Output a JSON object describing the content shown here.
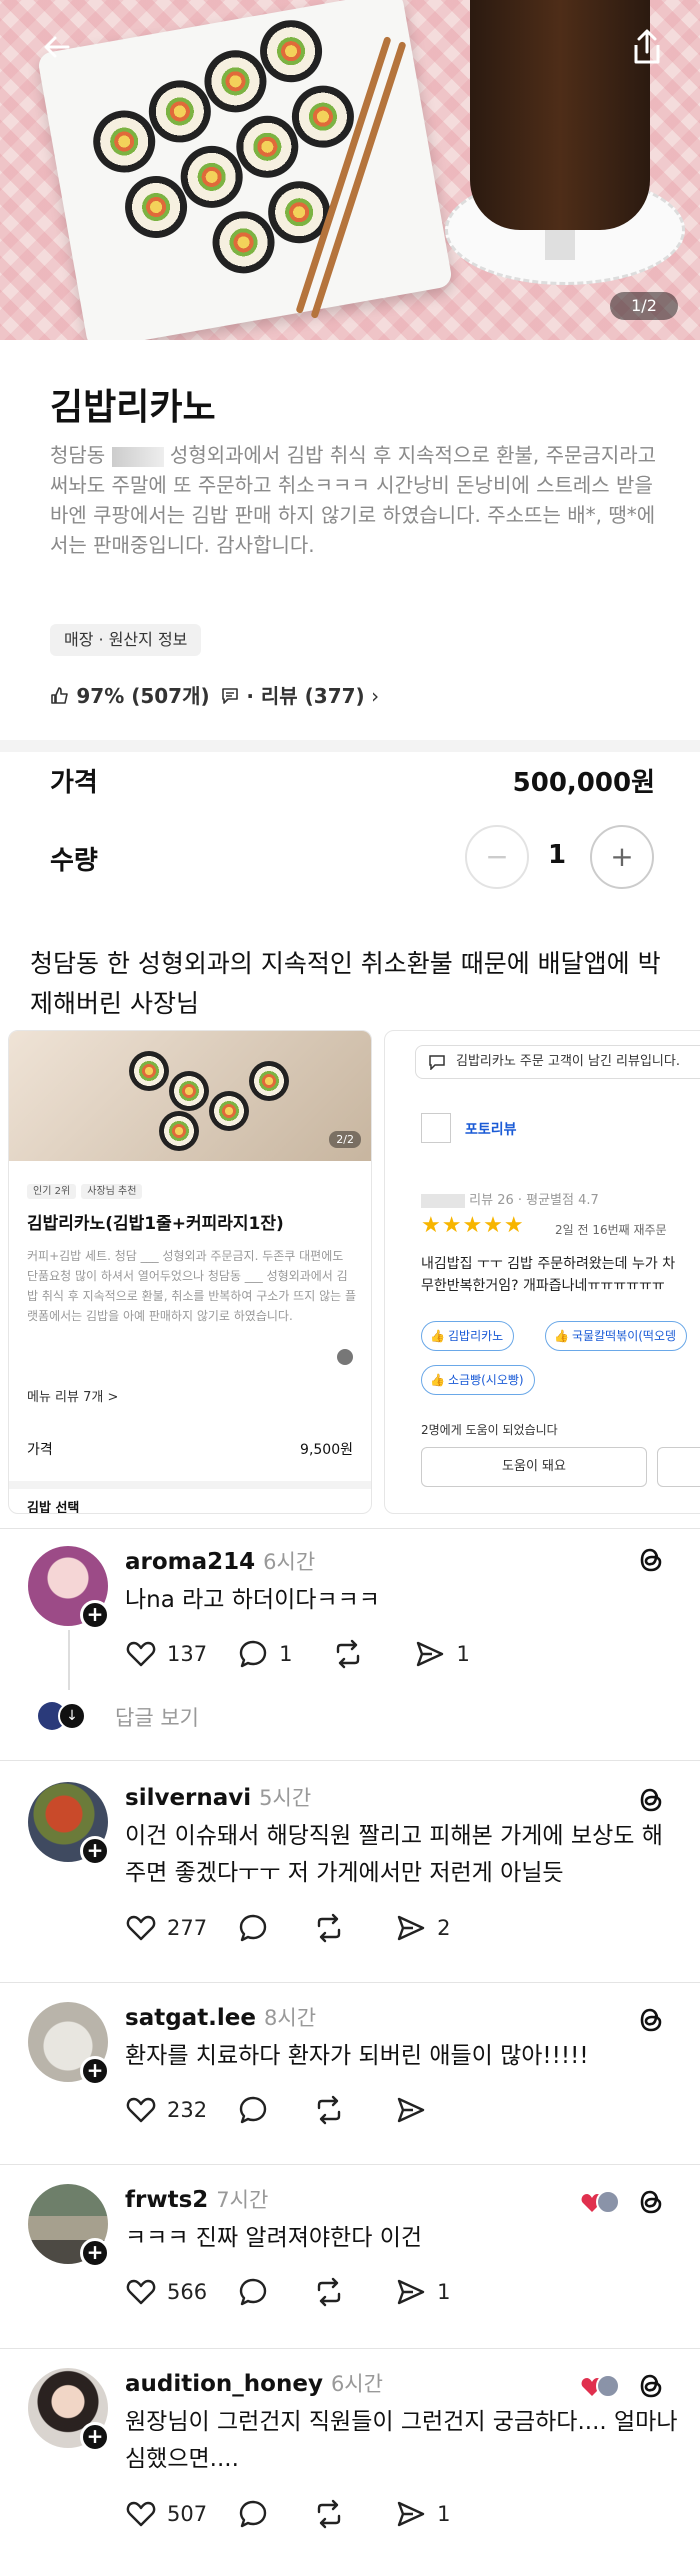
{
  "hero": {
    "page_indicator": "1/2"
  },
  "store": {
    "name": "김밥리카노",
    "desc_part1": "청담동 ",
    "desc_part2": " 성형외과에서 김밥 취식 후 지속적으로 환불, 주문금지라고 써놔도 주말에 또 주문하고 취소ㅋㅋㅋ 시간낭비 돈낭비에 스트레스 받을바엔 쿠팡에서는 김밥 판매 하지 않기로 하였습니다. 주소뜨는 배*, 땡*에서는 판매중입니다. 감사합니다.",
    "origin_badge": "매장 · 원산지 정보",
    "rating_pct": "97% (507개)",
    "review_label": "· 리뷰 (377)",
    "review_chevron": "›"
  },
  "price": {
    "label": "가격",
    "value": "500,000원"
  },
  "quantity": {
    "label": "수량",
    "value": "1",
    "minus": "−",
    "plus": "+"
  },
  "post_title": "청담동 한 성형외과의 지속적인 취소환불 때문에 배달앱에 박제해버린 사장님",
  "shot_left": {
    "page": "2/2",
    "tag1": "인기 2위",
    "tag2": "사장님 추천",
    "name": "김밥리카노(김밥1줄+커피라지1잔)",
    "desc": "커피+김밥 세트. 청담 ___ 성형외과 주문금지. 두존쿠 대편에도 단품요청 많이 하셔서 열어두었으나 청담동 ___ 성형외과에서 김밥 취식 후 지속적으로 환불, 취소를 반복하여 구소가 뜨지 않는 플랫폼에서는 김밥을 아예 판매하지 않기로 하였습니다.",
    "review": "메뉴 리뷰 7개 >",
    "price_label": "가격",
    "price": "9,500원",
    "select": "김밥 선택"
  },
  "shot_right": {
    "top": "김밥리카노 주문 고객이 남긴 리뷰입니다.",
    "photo_label": "포토리뷰",
    "user_meta": "리뷰 26 · 평균별점 4.7",
    "stars": "★★★★★",
    "date": "2일 전   16번째 재주문",
    "text_line1": "내김밥집 ㅜㅜ 김밥 주문하려왔는데 누가 차",
    "text_line2": "무한반복한거임? 개파즙나네ㅠㅠㅠㅠㅠㅠ",
    "chip1": "김밥리카노",
    "chip2": "국물칼떡볶이(떡오뎅",
    "chip3": "소금빵(시오빵)",
    "helpful": "2명에게 도움이 되었습니다",
    "help_btn": "도움이 돼요"
  },
  "comments": [
    {
      "user": "aroma214",
      "time": "6시간",
      "text": "나na 라고 하더이다ㅋㅋㅋ",
      "likes": "137",
      "replies": "1",
      "shares": "1",
      "view_replies": "답글 보기"
    },
    {
      "user": "silvernavi",
      "time": "5시간",
      "text": "이건 이슈돼서 해당직원 짤리고 피해본 가게에 보상도 해주면 좋겠다ㅜㅜ 저 가게에서만 저런게 아닐듯",
      "likes": "277",
      "replies": "",
      "shares": "2"
    },
    {
      "user": "satgat.lee",
      "time": "8시간",
      "text": "환자를 치료하다 환자가 되버린 애들이 많아!!!!!",
      "likes": "232",
      "replies": "",
      "shares": ""
    },
    {
      "user": "frwts2",
      "time": "7시간",
      "text": "ㅋㅋㅋ 진짜 알려져야한다 이건",
      "likes": "566",
      "replies": "",
      "shares": "1"
    },
    {
      "user": "audition_honey",
      "time": "6시간",
      "text": "원장님이 그런건지 직원들이 그런건지 궁금하다.... 얼마나 심했으면....",
      "likes": "507",
      "replies": "",
      "shares": "1"
    }
  ],
  "colors": {
    "star": "#f7b500",
    "link_blue": "#1a5bd6",
    "reaction_heart": "#e0304e"
  },
  "icons": [
    "back-arrow-icon",
    "share-icon",
    "thumbs-up-icon",
    "comment-icon",
    "heart-icon",
    "reply-icon",
    "repost-icon",
    "send-icon",
    "threads-icon",
    "plus-icon"
  ]
}
